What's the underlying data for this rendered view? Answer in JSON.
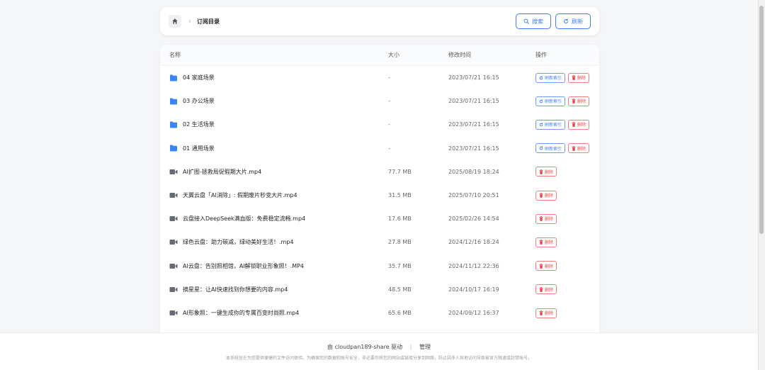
{
  "header": {
    "breadcrumb": "订阅目录",
    "search_label": "搜索",
    "refresh_label": "刷新"
  },
  "table": {
    "columns": {
      "name": "名称",
      "size": "大小",
      "modified": "修改时间",
      "actions": "操作"
    },
    "refresh_index_label": "刷新索引",
    "delete_label": "删除",
    "rows": [
      {
        "name": "04 家庭场景",
        "type": "folder",
        "size": "-",
        "modified": "2023/07/21 16:15"
      },
      {
        "name": "03 办公场景",
        "type": "folder",
        "size": "-",
        "modified": "2023/07/21 16:15"
      },
      {
        "name": "02 生活场景",
        "type": "folder",
        "size": "-",
        "modified": "2023/07/21 16:15"
      },
      {
        "name": "01 通用场景",
        "type": "folder",
        "size": "-",
        "modified": "2023/07/21 16:15"
      },
      {
        "name": "AI扩图-拯救局促假期大片.mp4",
        "type": "video",
        "size": "77.7 MB",
        "modified": "2025/08/19 18:24"
      },
      {
        "name": "天翼云盘「AI消除」: 假期废片秒变大片.mp4",
        "type": "video",
        "size": "31.5 MB",
        "modified": "2025/07/10 20:51"
      },
      {
        "name": "云盘接入DeepSeek满血版：免费稳定流畅.mp4",
        "type": "video",
        "size": "17.6 MB",
        "modified": "2025/02/26 14:54"
      },
      {
        "name": "绿色云盘：助力碳减，绿动美好生活！.mp4",
        "type": "video",
        "size": "27.8 MB",
        "modified": "2024/12/16 18:24"
      },
      {
        "name": "AI云盘：告别照相馆，AI解锁职业形象照！.MP4",
        "type": "video",
        "size": "35.7 MB",
        "modified": "2024/11/12 22:36"
      },
      {
        "name": "摘星星：让AI快速找到你想要的内容.mp4",
        "type": "video",
        "size": "48.5 MB",
        "modified": "2024/10/17 16:19"
      },
      {
        "name": "AI形象照：一键生成你的专属百变时尚照.mp4",
        "type": "video",
        "size": "65.6 MB",
        "modified": "2024/09/12 16:37"
      }
    ]
  },
  "footer": {
    "powered_by": "由 cloudpan189-share 驱动",
    "separator": "|",
    "admin_label": "管理",
    "disclaimer": "本系统旨在为您提供便捷的文件访问体验。为确保您的数据和账号安全，非必要勿将您的网站或链接分享到网络，防止因多人异地访问导致被官方限速或封禁账号。"
  },
  "colors": {
    "accent": "#3f7ef6",
    "danger": "#e04848",
    "folder": "#3a86f4",
    "video_icon": "#666a73"
  }
}
